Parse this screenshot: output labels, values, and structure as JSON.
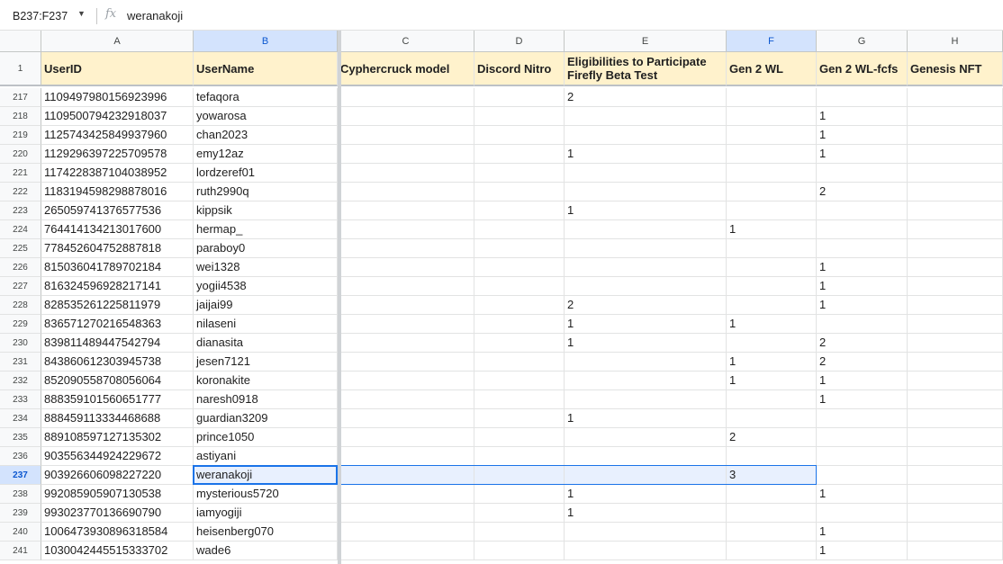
{
  "formula_bar": {
    "name_box": "B237:F237",
    "fx_icon": "fx-icon",
    "value": "weranakoji"
  },
  "columns": [
    "A",
    "B",
    "C",
    "D",
    "E",
    "F",
    "G",
    "H"
  ],
  "header_row": {
    "row_number": "1",
    "cells": [
      "UserID",
      "UserName",
      "Cyphercruck model",
      "Discord Nitro",
      "Eligibilities to Participate Firefly Beta Test",
      "Gen 2 WL",
      "Gen 2 WL-fcfs",
      "Genesis NFT"
    ]
  },
  "rows": [
    {
      "n": "217",
      "c": [
        "1109497980156923996",
        "tefaqora",
        "",
        "",
        "2",
        "",
        "",
        ""
      ]
    },
    {
      "n": "218",
      "c": [
        "1109500794232918037",
        "yowarosa",
        "",
        "",
        "",
        "",
        "1",
        ""
      ]
    },
    {
      "n": "219",
      "c": [
        "1125743425849937960",
        "chan2023",
        "",
        "",
        "",
        "",
        "1",
        ""
      ]
    },
    {
      "n": "220",
      "c": [
        "1129296397225709578",
        "emy12az",
        "",
        "",
        "1",
        "",
        "1",
        ""
      ]
    },
    {
      "n": "221",
      "c": [
        "1174228387104038952",
        "lordzeref01",
        "",
        "",
        "",
        "",
        "",
        ""
      ]
    },
    {
      "n": "222",
      "c": [
        "1183194598298878016",
        "ruth2990q",
        "",
        "",
        "",
        "",
        "2",
        ""
      ]
    },
    {
      "n": "223",
      "c": [
        "265059741376577536",
        "kippsik",
        "",
        "",
        "1",
        "",
        "",
        ""
      ]
    },
    {
      "n": "224",
      "c": [
        "764414134213017600",
        "hermap_",
        "",
        "",
        "",
        "1",
        "",
        ""
      ]
    },
    {
      "n": "225",
      "c": [
        "778452604752887818",
        "paraboy0",
        "",
        "",
        "",
        "",
        "",
        ""
      ]
    },
    {
      "n": "226",
      "c": [
        "815036041789702184",
        "wei1328",
        "",
        "",
        "",
        "",
        "1",
        ""
      ]
    },
    {
      "n": "227",
      "c": [
        "816324596928217141",
        "yogii4538",
        "",
        "",
        "",
        "",
        "1",
        ""
      ]
    },
    {
      "n": "228",
      "c": [
        "828535261225811979",
        "jaijai99",
        "",
        "",
        "2",
        "",
        "1",
        ""
      ]
    },
    {
      "n": "229",
      "c": [
        "836571270216548363",
        "nilaseni",
        "",
        "",
        "1",
        "1",
        "",
        ""
      ]
    },
    {
      "n": "230",
      "c": [
        "839811489447542794",
        "dianasita",
        "",
        "",
        "1",
        "",
        "2",
        ""
      ]
    },
    {
      "n": "231",
      "c": [
        "843860612303945738",
        "jesen7121",
        "",
        "",
        "",
        "1",
        "2",
        ""
      ]
    },
    {
      "n": "232",
      "c": [
        "852090558708056064",
        "koronakite",
        "",
        "",
        "",
        "1",
        "1",
        ""
      ]
    },
    {
      "n": "233",
      "c": [
        "888359101560651777",
        "naresh0918",
        "",
        "",
        "",
        "",
        "1",
        ""
      ]
    },
    {
      "n": "234",
      "c": [
        "888459113334468688",
        "guardian3209",
        "",
        "",
        "1",
        "",
        "",
        ""
      ]
    },
    {
      "n": "235",
      "c": [
        "889108597127135302",
        "prince1050",
        "",
        "",
        "",
        "2",
        "",
        ""
      ]
    },
    {
      "n": "236",
      "c": [
        "903556344924229672",
        "astiyani",
        "",
        "",
        "",
        "",
        "",
        ""
      ]
    },
    {
      "n": "237",
      "c": [
        "903926606098227220",
        "weranakoji",
        "",
        "",
        "",
        "3",
        "",
        ""
      ],
      "selected": true
    },
    {
      "n": "238",
      "c": [
        "992085905907130538",
        "mysterious5720",
        "",
        "",
        "1",
        "",
        "1",
        ""
      ]
    },
    {
      "n": "239",
      "c": [
        "993023770136690790",
        "iamyogiji",
        "",
        "",
        "1",
        "",
        "",
        ""
      ]
    },
    {
      "n": "240",
      "c": [
        "1006473930896318584",
        "heisenberg070",
        "",
        "",
        "",
        "",
        "1",
        ""
      ]
    },
    {
      "n": "241",
      "c": [
        "1030042445515333702",
        "wade6",
        "",
        "",
        "",
        "",
        "1",
        ""
      ]
    }
  ],
  "colors": {
    "header_fill": "#fff2cc",
    "selection": "#1a73e8",
    "selected_header": "#d3e3fd"
  }
}
